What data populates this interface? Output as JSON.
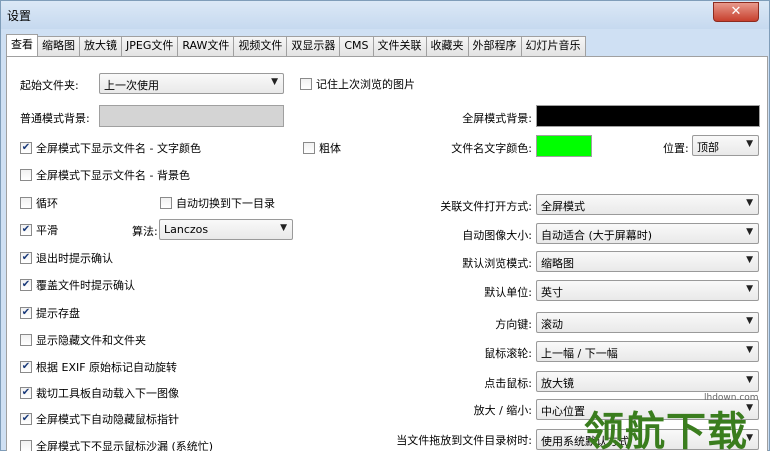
{
  "window": {
    "title": "设置",
    "close_glyph": "✕"
  },
  "tabs": [
    "查看",
    "缩略图",
    "放大镜",
    "JPEG文件",
    "RAW文件",
    "视频文件",
    "双显示器",
    "CMS",
    "文件关联",
    "收藏夹",
    "外部程序",
    "幻灯片音乐"
  ],
  "left": {
    "start_folder_label": "起始文件夹:",
    "start_folder_value": "上一次使用",
    "remember_last_image": "记住上次浏览的图片",
    "normal_bg_label": "普通模式背景:",
    "show_filename_text_color": "全屏模式下显示文件名 - 文字颜色",
    "bold": "粗体",
    "show_filename_bg_color": "全屏模式下显示文件名 - 背景色",
    "loop": "循环",
    "auto_next_folder": "自动切换到下一目录",
    "smooth": "平滑",
    "algorithm_label": "算法:",
    "algorithm_value": "Lanczos",
    "confirm_exit": "退出时提示确认",
    "confirm_overwrite": "覆盖文件时提示确认",
    "prompt_save": "提示存盘",
    "show_hidden": "显示隐藏文件和文件夹",
    "exif_rotate": "根据 EXIF 原始标记自动旋转",
    "crop_auto_next": "裁切工具板自动载入下一图像",
    "auto_hide_cursor": "全屏模式下自动隐藏鼠标指针",
    "no_hourglass": "全屏模式下不显示鼠标沙漏 (系统忙)"
  },
  "right": {
    "fullscreen_bg_label": "全屏模式背景:",
    "filename_color_label": "文件名文字颜色:",
    "position_label": "位置:",
    "position_value": "顶部",
    "assoc_open_label": "关联文件打开方式:",
    "assoc_open_value": "全屏模式",
    "auto_size_label": "自动图像大小:",
    "auto_size_value": "自动适合 (大于屏幕时)",
    "default_browse_label": "默认浏览模式:",
    "default_browse_value": "缩略图",
    "default_unit_label": "默认单位:",
    "default_unit_value": "英寸",
    "arrow_keys_label": "方向键:",
    "arrow_keys_value": "滚动",
    "mouse_wheel_label": "鼠标滚轮:",
    "mouse_wheel_value": "上一幅 / 下一幅",
    "mouse_click_label": "点击鼠标:",
    "mouse_click_value": "放大镜",
    "zoom_label": "放大 / 缩小:",
    "zoom_value": "中心位置",
    "drag_label": "当文件拖放到文件目录树时:",
    "drag_value": "使用系统默认方式"
  },
  "colors": {
    "normal_bg": "#d4d4d4",
    "fullscreen_bg": "#000000",
    "filename_text": "#00ff00"
  },
  "watermark": {
    "text": "领航下载",
    "site": "lhdown.com"
  }
}
